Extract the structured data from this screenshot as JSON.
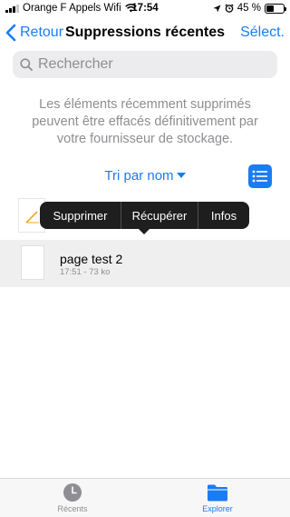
{
  "status_bar": {
    "carrier": "Orange F Appels Wifi",
    "time": "17:54",
    "battery": "45 %",
    "battery_level": 0.45
  },
  "nav": {
    "back_label": "Retour",
    "title": "Suppressions récentes",
    "select_label": "Sélect."
  },
  "search": {
    "placeholder": "Rechercher"
  },
  "info_text": "Les éléments récemment supprimés peuvent être effacés définitivement par votre fournisseur de stockage.",
  "sort": {
    "label": "Tri par nom"
  },
  "context_menu": {
    "items": [
      "Supprimer",
      "Récupérer",
      "Infos"
    ]
  },
  "file": {
    "name": "page test 2",
    "meta": "17:51 - 73 ko"
  },
  "tabs": [
    {
      "label": "Récents",
      "icon": "clock-icon"
    },
    {
      "label": "Explorer",
      "icon": "folder-icon"
    }
  ],
  "colors": {
    "accent": "#1a7cf5",
    "secondary_text": "#8e8e93",
    "menu_bg": "#1e1e1f"
  }
}
